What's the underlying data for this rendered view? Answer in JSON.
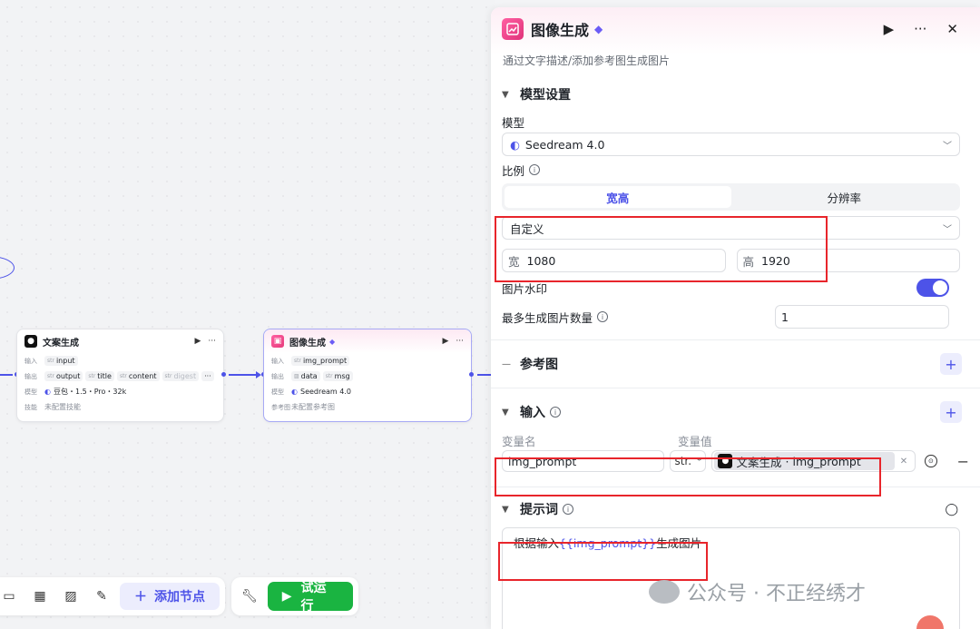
{
  "canvas": {
    "node1": {
      "title": "文案生成",
      "input_label": "输入",
      "input_tags": [
        "input"
      ],
      "output_label": "输出",
      "output_tags": [
        "output",
        "title",
        "content",
        "digest"
      ],
      "model_label": "模型",
      "model_value": "豆包・1.5・Pro・32k",
      "skill_label": "技能",
      "skill_value": "未配置技能",
      "type_prefix": "str",
      "more": "···"
    },
    "node2": {
      "title": "图像生成",
      "input_label": "输入",
      "input_tags": [
        "img_prompt"
      ],
      "output_label": "输出",
      "output_tags": [
        "data",
        "msg"
      ],
      "model_label": "模型",
      "model_value": "Seedream 4.0",
      "ref_label": "参考图",
      "ref_value": "未配置参考图",
      "type_prefix": "str"
    },
    "toolbar": {
      "add_node": "添加节点",
      "run": "试运行"
    }
  },
  "panel": {
    "title": "图像生成",
    "description": "通过文字描述/添加参考图生成图片",
    "model_section": {
      "title": "模型设置",
      "model_label": "模型",
      "model_value": "Seedream 4.0",
      "ratio_label": "比例",
      "segments": [
        "宽高",
        "分辨率"
      ],
      "preset": "自定义",
      "width_prefix": "宽",
      "width_value": "1080",
      "height_prefix": "高",
      "height_value": "1920",
      "watermark_label": "图片水印",
      "watermark_on": true,
      "max_count_label": "最多生成图片数量",
      "max_count_value": "1"
    },
    "ref_section": {
      "title": "参考图"
    },
    "input_section": {
      "title": "输入",
      "col_name": "变量名",
      "col_value": "变量值",
      "var_name": "img_prompt",
      "var_type": "str.",
      "ref_node": "文案生成",
      "ref_sep": "·",
      "ref_var": "img_prompt"
    },
    "prompt_section": {
      "title": "提示词",
      "prefix": "根据输入",
      "variable": "{{img_prompt}}",
      "suffix": "生成图片"
    }
  },
  "watermark_text": "公众号 · 不正经绣才",
  "colors": {
    "accent": "#4d53e8",
    "run_green": "#1ab441",
    "highlight_red": "#e8252b",
    "brand_pink": "#e63c7c"
  }
}
